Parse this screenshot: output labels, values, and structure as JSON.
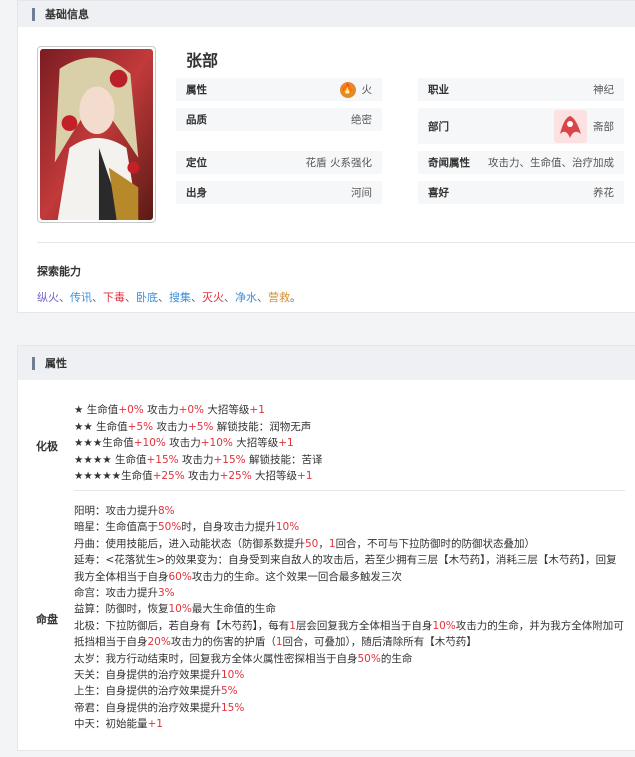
{
  "basic": {
    "header": "基础信息",
    "name": "张部",
    "attrs": {
      "property": {
        "label": "属性",
        "value": "火"
      },
      "job": {
        "label": "职业",
        "value": "神纪"
      },
      "quality": {
        "label": "品质",
        "value": "绝密"
      },
      "dept": {
        "label": "部门",
        "value": "斋部"
      },
      "position": {
        "label": "定位",
        "value": "花盾 火系强化"
      },
      "qiwen": {
        "label": "奇闻属性",
        "value": "攻击力、生命值、治疗加成"
      },
      "origin": {
        "label": "出身",
        "value": "河间"
      },
      "hobby": {
        "label": "喜好",
        "value": "养花"
      }
    },
    "explore_title": "探索能力",
    "explore": [
      {
        "text": "纵火",
        "color": "#6f66c9"
      },
      {
        "text": "传讯",
        "color": "#3b8fd8"
      },
      {
        "text": "下毒",
        "color": "#e0323c"
      },
      {
        "text": "卧底",
        "color": "#3b8fd8"
      },
      {
        "text": "搜集",
        "color": "#3b8fd8"
      },
      {
        "text": "灭火",
        "color": "#e0323c"
      },
      {
        "text": "净水",
        "color": "#3b8fd8"
      },
      {
        "text": "营救",
        "color": "#d4902e"
      }
    ],
    "explore_sep": "、",
    "explore_end": "。"
  },
  "attributes": {
    "header": "属性",
    "huaji_label": "化极",
    "huaji": [
      [
        "★ 生命值",
        {
          "r": "+0%"
        },
        " 攻击力",
        {
          "r": "+0%"
        },
        " 大招等级",
        {
          "r": "+1"
        }
      ],
      [
        "★★ 生命值",
        {
          "r": "+5%"
        },
        " 攻击力",
        {
          "r": "+5%"
        },
        " 解锁技能：润物无声"
      ],
      [
        "★★★生命值",
        {
          "r": "+10%"
        },
        " 攻击力",
        {
          "r": "+10%"
        },
        " 大招等级",
        {
          "r": "+1"
        }
      ],
      [
        "★★★★ 生命值",
        {
          "r": "+15%"
        },
        " 攻击力",
        {
          "r": "+15%"
        },
        " 解锁技能：苦译"
      ],
      [
        "★★★★★生命值",
        {
          "r": "+25%"
        },
        " 攻击力",
        {
          "r": "+25%"
        },
        " 大招等级",
        {
          "r": "+1"
        }
      ]
    ],
    "mingpan_label": "命盘",
    "mingpan": [
      [
        "阳明：攻击力提升",
        {
          "r": "8%"
        }
      ],
      [
        "暗星：生命值高于",
        {
          "r": "50%"
        },
        "时，自身攻击力提升",
        {
          "r": "10%"
        }
      ],
      [
        "丹曲：使用技能后，进入动能状态（防御系数提升",
        {
          "r": "50"
        },
        "，",
        {
          "r": "1"
        },
        "回合，不可与下拉防御时的防御状态叠加）"
      ],
      [
        "延寿：<花落犹生>的效果变为：自身受到来自敌人的攻击后，若至少拥有三层【木芍药】，消耗三层【木芍药】，回复"
      ],
      [
        "我方全体相当于自身",
        {
          "r": "60%"
        },
        "攻击力的生命。这个效果一回合最多触发三次"
      ],
      [
        "命宫：攻击力提升",
        {
          "r": "3%"
        }
      ],
      [
        "益算：防御时，恢复",
        {
          "r": "10%"
        },
        "最大生命值的生命"
      ],
      [
        "北极：下拉防御后，若自身有【木芍药】，每有",
        {
          "r": "1"
        },
        "层会回复我方全体相当于自身",
        {
          "r": "10%"
        },
        "攻击力的生命，并为我方全体附加可"
      ],
      [
        "抵挡相当于自身",
        {
          "r": "20%"
        },
        "攻击力的伤害的护盾（",
        {
          "r": "1"
        },
        "回合，可叠加），随后清除所有【木芍药】"
      ],
      [
        "太岁：我方行动结束时，回复我方全体火属性密探相当于自身",
        {
          "r": "50%"
        },
        "的生命"
      ],
      [
        "天关：自身提供的治疗效果提升",
        {
          "r": "10%"
        }
      ],
      [
        "上生：自身提供的治疗效果提升",
        {
          "r": "5%"
        }
      ],
      [
        "帝君：自身提供的治疗效果提升",
        {
          "r": "15%"
        }
      ],
      [
        "中天：初始能量",
        {
          "r": "+1"
        }
      ]
    ]
  }
}
